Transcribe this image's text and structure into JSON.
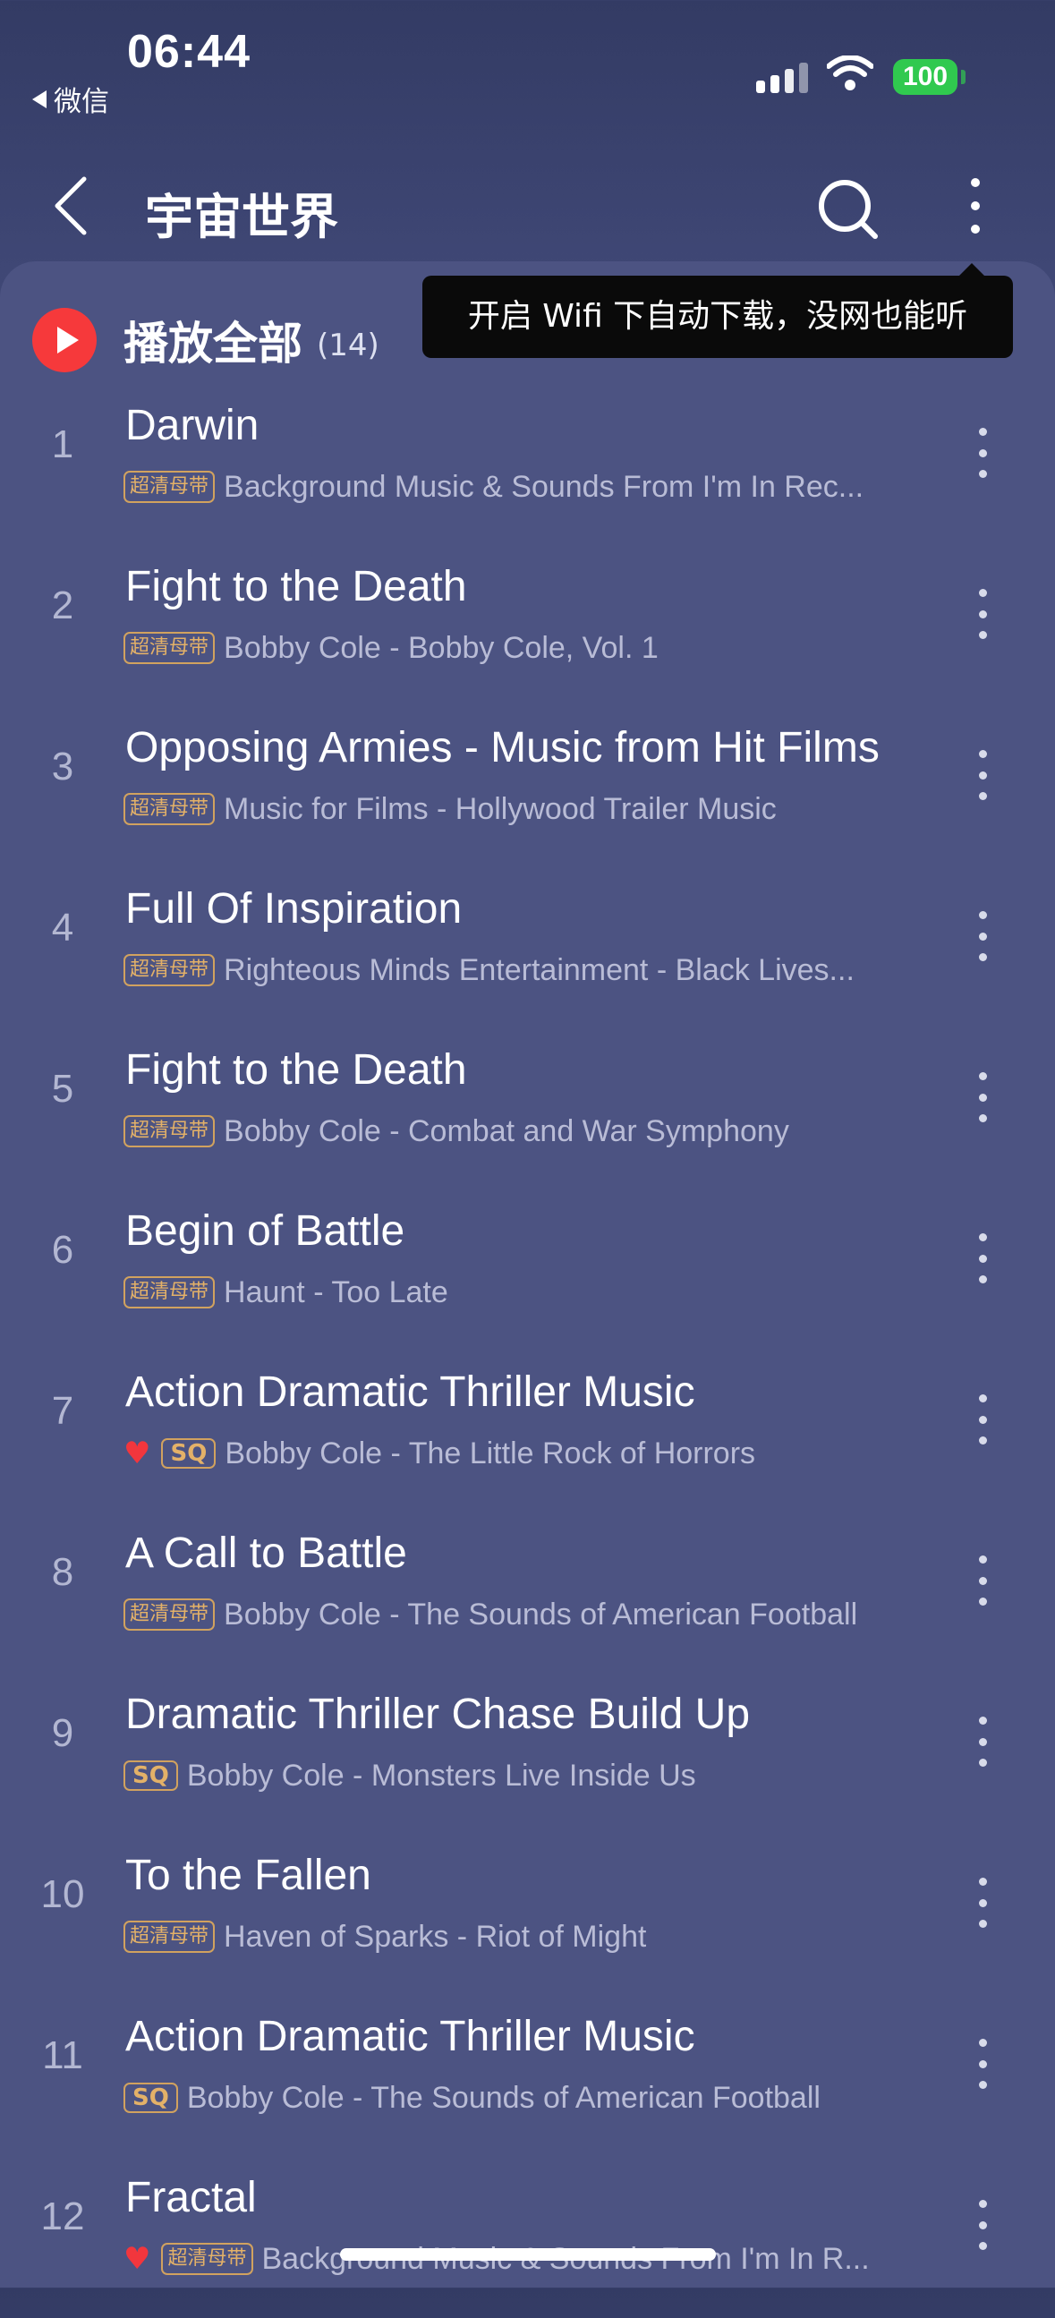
{
  "status_bar": {
    "time": "06:44",
    "back_app_label": "微信",
    "battery": "100"
  },
  "header": {
    "title": "宇宙世界"
  },
  "play_all": {
    "label": "播放全部",
    "count": "(14)"
  },
  "tooltip": {
    "text": "开启 Wifi 下自动下载，没网也能听"
  },
  "badges": {
    "lossless": "超清母带",
    "sq": "SQ"
  },
  "colors": {
    "accent_red": "#f6393b",
    "badge_gold": "#e3b168",
    "battery_green": "#30c94f",
    "background": "#4c5382"
  },
  "songs": [
    {
      "num": "1",
      "title": "Darwin",
      "subtitle": "Background Music & Sounds From I'm In Rec...",
      "badge": "超清母带",
      "liked": false
    },
    {
      "num": "2",
      "title": "Fight to the Death",
      "subtitle": "Bobby Cole - Bobby Cole, Vol. 1",
      "badge": "超清母带",
      "liked": false
    },
    {
      "num": "3",
      "title": "Opposing Armies - Music from Hit Films",
      "subtitle": "Music for Films - Hollywood Trailer Music",
      "badge": "超清母带",
      "liked": false
    },
    {
      "num": "4",
      "title": "Full Of Inspiration",
      "subtitle": "Righteous Minds Entertainment - Black Lives...",
      "badge": "超清母带",
      "liked": false
    },
    {
      "num": "5",
      "title": "Fight to the Death",
      "subtitle": "Bobby Cole - Combat and War Symphony",
      "badge": "超清母带",
      "liked": false
    },
    {
      "num": "6",
      "title": "Begin of Battle",
      "subtitle": "Haunt - Too Late",
      "badge": "超清母带",
      "liked": false
    },
    {
      "num": "7",
      "title": "Action Dramatic Thriller Music",
      "subtitle": "Bobby Cole - The Little Rock of Horrors",
      "badge": "SQ",
      "liked": true
    },
    {
      "num": "8",
      "title": "A Call to Battle",
      "subtitle": "Bobby Cole - The Sounds of American Football",
      "badge": "超清母带",
      "liked": false
    },
    {
      "num": "9",
      "title": "Dramatic Thriller Chase Build Up",
      "subtitle": "Bobby Cole - Monsters Live Inside Us",
      "badge": "SQ",
      "liked": false
    },
    {
      "num": "10",
      "title": "To the Fallen",
      "subtitle": "Haven of Sparks - Riot of Might",
      "badge": "超清母带",
      "liked": false
    },
    {
      "num": "11",
      "title": "Action Dramatic Thriller Music",
      "subtitle": "Bobby Cole - The Sounds of American Football",
      "badge": "SQ",
      "liked": false
    },
    {
      "num": "12",
      "title": "Fractal",
      "subtitle": "Background Music & Sounds From I'm In R...",
      "badge": "超清母带",
      "liked": true
    }
  ]
}
